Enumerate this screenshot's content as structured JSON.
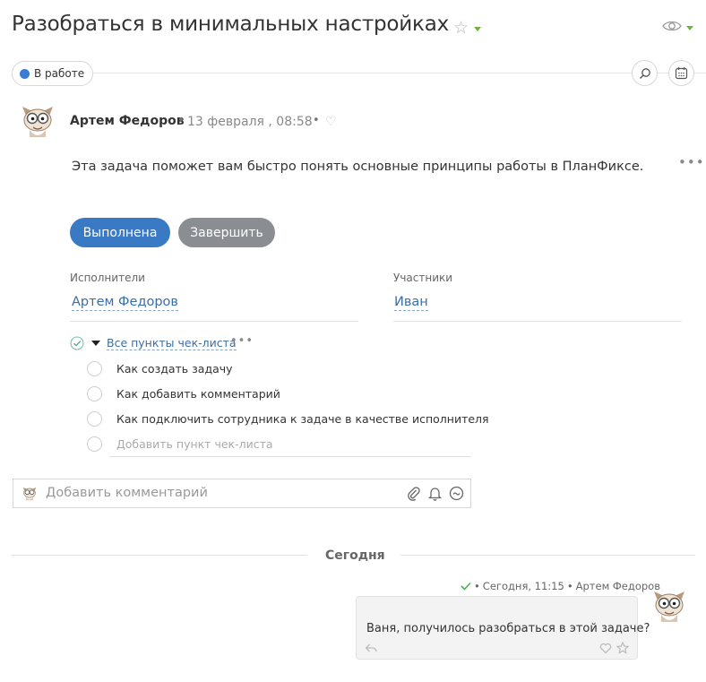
{
  "task": {
    "title": "Разобраться в минимальных настройках",
    "status": "В работе"
  },
  "post": {
    "author": "Артем Федоров",
    "date": "13 февраля , 08:58",
    "description": "Эта задача поможет вам быстро понять основные принципы работы в ПланФиксе."
  },
  "actions": {
    "done_label": "Выполнена",
    "finish_label": "Завершить"
  },
  "fields": {
    "assignees_label": "Исполнители",
    "assignees_value": "Артем Федоров",
    "participants_label": "Участники",
    "participants_value": "Иван"
  },
  "checklist": {
    "title": "Все пункты чек-листа",
    "items": [
      {
        "label": "Как создать задачу",
        "checked": false
      },
      {
        "label": "Как добавить комментарий",
        "checked": false
      },
      {
        "label": "Как подключить сотрудника к задаче в качестве исполнителя",
        "checked": false
      }
    ],
    "add_placeholder": "Добавить пункт чек-листа"
  },
  "comment_input": {
    "placeholder": "Добавить комментарий"
  },
  "feed": {
    "day_label": "Сегодня",
    "message": {
      "time": "Сегодня, 11:15",
      "author": "Артем Федоров",
      "text": "Ваня, получилось разобраться в этой задаче?"
    }
  },
  "colors": {
    "accent_blue": "#3a79c4",
    "status_blue": "#3a7bd5",
    "link_blue": "#3a6ea5",
    "gray_button": "#8a8d91",
    "green": "#6fb33a"
  }
}
